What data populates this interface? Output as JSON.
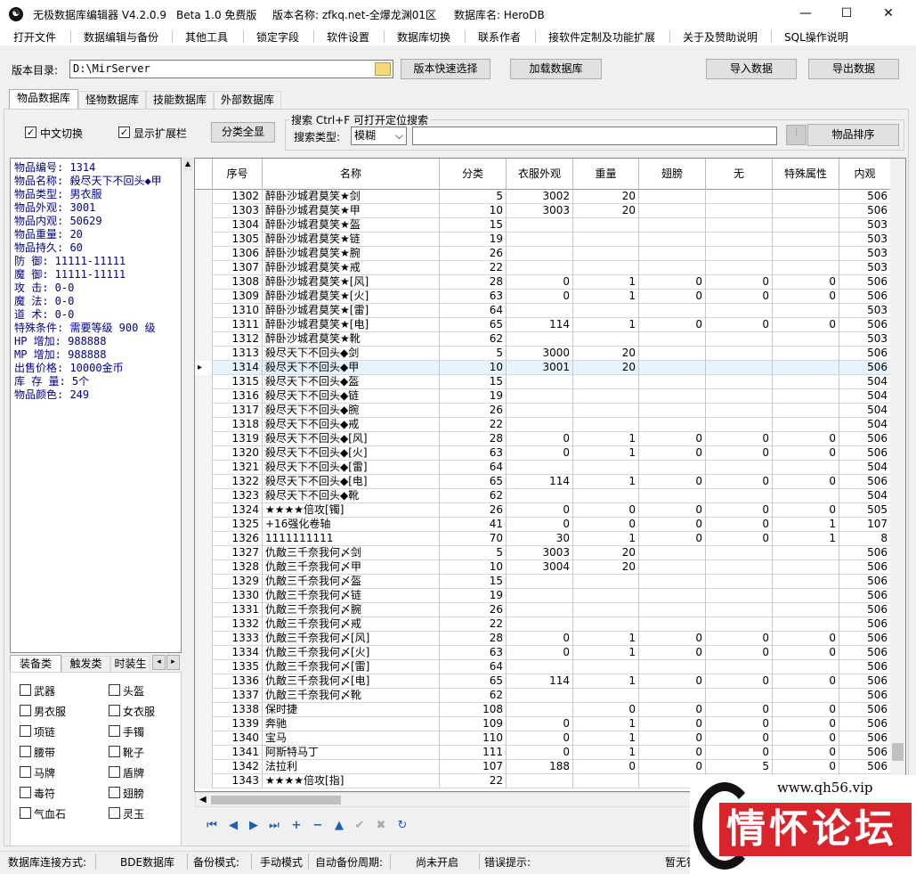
{
  "titlebar": {
    "app_name": "无极数据库编辑器 V4.2.0.9",
    "edition": "Beta 1.0 免费版",
    "version_name": "版本名称: zfkq.net-全爆龙渊01区",
    "db_name": "数据库名: HeroDB"
  },
  "menu": [
    "打开文件",
    "数据编辑与备份",
    "其他工具",
    "锁定字段",
    "软件设置",
    "数据库切换",
    "联系作者",
    "接软件定制及功能扩展",
    "关于及赞助说明",
    "SQL操作说明"
  ],
  "toolbar": {
    "dir_label": "版本目录:",
    "dir_value": "D:\\MirServer",
    "quick_select": "版本快速选择",
    "load_db": "加载数据库",
    "import": "导入数据",
    "export": "导出数据"
  },
  "tabs": [
    "物品数据库",
    "怪物数据库",
    "技能数据库",
    "外部数据库"
  ],
  "options": {
    "chinese_switch": "中文切换",
    "show_ext": "显示扩展栏",
    "show_all": "分类全显",
    "search_title": "搜索  Ctrl+F 可打开定位搜索",
    "search_type_label": "搜索类型:",
    "search_type_value": "模糊",
    "sort_button": "物品排序"
  },
  "info": [
    "物品编号: 1314",
    "物品名称: 殺尽天下不回头◆甲",
    "物品类型: 男衣服",
    "物品外观: 3001",
    "物品内观: 50629",
    "物品重量: 20",
    "物品持久: 60",
    "防    御: 11111-11111",
    "魔    御: 11111-11111",
    "攻    击: 0-0",
    "魔    法: 0-0",
    "道    术: 0-0",
    "特殊条件: 需要等级 900 级",
    "HP  增加: 988888",
    "MP  增加: 988888",
    "出售价格: 10000金币",
    "库 存 量: 5个",
    "物品颜色: 249"
  ],
  "category_tabs": [
    "装备类",
    "触发类",
    "时装生"
  ],
  "categories": [
    "武器",
    "头盔",
    "男衣服",
    "女衣服",
    "项链",
    "手镯",
    "腰带",
    "靴子",
    "马牌",
    "盾牌",
    "毒符",
    "翅膀",
    "气血石",
    "灵玉"
  ],
  "columns": [
    "序号",
    "名称",
    "分类",
    "衣服外观",
    "重量",
    "翅膀",
    "无",
    "特殊属性",
    "内观"
  ],
  "rows": [
    [
      "1302",
      "醉卧沙城君莫笑★剑",
      "5",
      "3002",
      "20",
      "",
      "",
      "",
      "506"
    ],
    [
      "1303",
      "醉卧沙城君莫笑★甲",
      "10",
      "3003",
      "20",
      "",
      "",
      "",
      "506"
    ],
    [
      "1304",
      "醉卧沙城君莫笑★盔",
      "15",
      "",
      "",
      "",
      "",
      "",
      "503"
    ],
    [
      "1305",
      "醉卧沙城君莫笑★链",
      "19",
      "",
      "",
      "",
      "",
      "",
      "503"
    ],
    [
      "1306",
      "醉卧沙城君莫笑★腕",
      "26",
      "",
      "",
      "",
      "",
      "",
      "503"
    ],
    [
      "1307",
      "醉卧沙城君莫笑★戒",
      "22",
      "",
      "",
      "",
      "",
      "",
      "503"
    ],
    [
      "1308",
      "醉卧沙城君莫笑★[风]",
      "28",
      "0",
      "1",
      "0",
      "0",
      "0",
      "506"
    ],
    [
      "1309",
      "醉卧沙城君莫笑★[火]",
      "63",
      "0",
      "1",
      "0",
      "0",
      "0",
      "506"
    ],
    [
      "1310",
      "醉卧沙城君莫笑★[雷]",
      "64",
      "",
      "",
      "",
      "",
      "",
      "503"
    ],
    [
      "1311",
      "醉卧沙城君莫笑★[电]",
      "65",
      "114",
      "1",
      "0",
      "0",
      "0",
      "506"
    ],
    [
      "1312",
      "醉卧沙城君莫笑★靴",
      "62",
      "",
      "",
      "",
      "",
      "",
      "503"
    ],
    [
      "1313",
      "殺尽天下不回头◆剑",
      "5",
      "3000",
      "20",
      "",
      "",
      "",
      "506"
    ],
    [
      "1314",
      "殺尽天下不回头◆甲",
      "10",
      "3001",
      "20",
      "",
      "",
      "",
      "506"
    ],
    [
      "1315",
      "殺尽天下不回头◆盔",
      "15",
      "",
      "",
      "",
      "",
      "",
      "504"
    ],
    [
      "1316",
      "殺尽天下不回头◆链",
      "19",
      "",
      "",
      "",
      "",
      "",
      "504"
    ],
    [
      "1317",
      "殺尽天下不回头◆腕",
      "26",
      "",
      "",
      "",
      "",
      "",
      "504"
    ],
    [
      "1318",
      "殺尽天下不回头◆戒",
      "22",
      "",
      "",
      "",
      "",
      "",
      "504"
    ],
    [
      "1319",
      "殺尽天下不回头◆[风]",
      "28",
      "0",
      "1",
      "0",
      "0",
      "0",
      "506"
    ],
    [
      "1320",
      "殺尽天下不回头◆[火]",
      "63",
      "0",
      "1",
      "0",
      "0",
      "0",
      "506"
    ],
    [
      "1321",
      "殺尽天下不回头◆[雷]",
      "64",
      "",
      "",
      "",
      "",
      "",
      "504"
    ],
    [
      "1322",
      "殺尽天下不回头◆[电]",
      "65",
      "114",
      "1",
      "0",
      "0",
      "0",
      "506"
    ],
    [
      "1323",
      "殺尽天下不回头◆靴",
      "62",
      "",
      "",
      "",
      "",
      "",
      "504"
    ],
    [
      "1324",
      "★★★★倍攻[镯]",
      "26",
      "0",
      "0",
      "0",
      "0",
      "0",
      "505"
    ],
    [
      "1325",
      "+16强化卷轴",
      "41",
      "0",
      "0",
      "0",
      "0",
      "1",
      "107"
    ],
    [
      "1326",
      "1111111111",
      "70",
      "30",
      "1",
      "0",
      "0",
      "1",
      "8"
    ],
    [
      "1327",
      "仇敵三千奈我何〆剑",
      "5",
      "3003",
      "20",
      "",
      "",
      "",
      "506"
    ],
    [
      "1328",
      "仇敵三千奈我何〆甲",
      "10",
      "3004",
      "20",
      "",
      "",
      "",
      "506"
    ],
    [
      "1329",
      "仇敵三千奈我何〆盔",
      "15",
      "",
      "",
      "",
      "",
      "",
      "506"
    ],
    [
      "1330",
      "仇敵三千奈我何〆链",
      "19",
      "",
      "",
      "",
      "",
      "",
      "506"
    ],
    [
      "1331",
      "仇敵三千奈我何〆腕",
      "26",
      "",
      "",
      "",
      "",
      "",
      "506"
    ],
    [
      "1332",
      "仇敵三千奈我何〆戒",
      "22",
      "",
      "",
      "",
      "",
      "",
      "506"
    ],
    [
      "1333",
      "仇敵三千奈我何〆[风]",
      "28",
      "0",
      "1",
      "0",
      "0",
      "0",
      "506"
    ],
    [
      "1334",
      "仇敵三千奈我何〆[火]",
      "63",
      "0",
      "1",
      "0",
      "0",
      "0",
      "506"
    ],
    [
      "1335",
      "仇敵三千奈我何〆[雷]",
      "64",
      "",
      "",
      "",
      "",
      "",
      "506"
    ],
    [
      "1336",
      "仇敵三千奈我何〆[电]",
      "65",
      "114",
      "1",
      "0",
      "0",
      "0",
      "506"
    ],
    [
      "1337",
      "仇敵三千奈我何〆靴",
      "62",
      "",
      "",
      "",
      "",
      "",
      "506"
    ],
    [
      "1338",
      "保时捷",
      "108",
      "",
      "0",
      "0",
      "0",
      "0",
      "506"
    ],
    [
      "1339",
      "奔驰",
      "109",
      "0",
      "1",
      "0",
      "0",
      "0",
      "506"
    ],
    [
      "1340",
      "宝马",
      "110",
      "0",
      "1",
      "0",
      "0",
      "0",
      "506"
    ],
    [
      "1341",
      "阿斯特马丁",
      "111",
      "0",
      "1",
      "0",
      "0",
      "0",
      "506"
    ],
    [
      "1342",
      "法拉利",
      "107",
      "188",
      "0",
      "0",
      "5",
      "0",
      "506"
    ],
    [
      "1343",
      "★★★★倍攻[指]",
      "22",
      "",
      "",
      "",
      "",
      "",
      ""
    ]
  ],
  "selected_row": "1314",
  "status": [
    "数据库连接方式:",
    "BDE数据库",
    "备份模式:",
    "手动模式",
    "自动备份周期:",
    "尚未开启",
    "错误提示:",
    "暂无错"
  ],
  "watermark": {
    "url": "www.qh56.vip",
    "name": "情怀论坛"
  },
  "colors": {
    "info_text": "#00008b",
    "nav_blue": "#1e5fb4",
    "selected_row": "#e5f3ff",
    "watermark_red": "#d9242b"
  }
}
